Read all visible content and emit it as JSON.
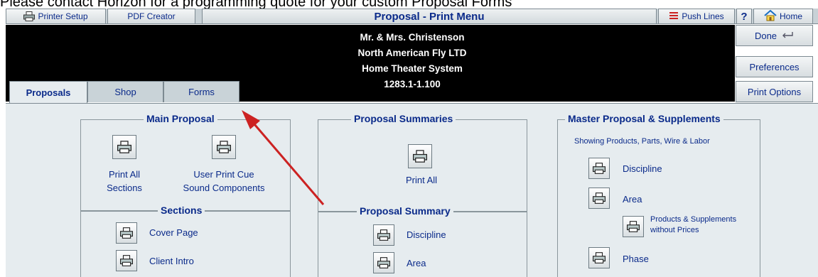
{
  "caption": "Please contact Horizon for a programming quote for your custom Proposal Forms",
  "toolbar": {
    "printer_setup": "Printer Setup",
    "pdf_creator": "PDF Creator",
    "title": "Proposal - Print Menu",
    "push_lines": "Push Lines",
    "help": "?",
    "home": "Home"
  },
  "client": {
    "name": "Mr. & Mrs. Christenson",
    "company": "North American Fly LTD",
    "project": "Home Theater System",
    "number": "1283.1-1.100"
  },
  "side": {
    "done": "Done",
    "preferences": "Preferences",
    "print_options": "Print Options"
  },
  "tabs": [
    "Proposals",
    "Shop",
    "Forms"
  ],
  "main_proposal": {
    "title": "Main Proposal",
    "print_all": "Print All\nSections",
    "user_print": "User Print Cue\nSound Components"
  },
  "sections": {
    "title": "Sections",
    "items": [
      "Cover Page",
      "Client Intro"
    ]
  },
  "summaries": {
    "title": "Proposal Summaries",
    "print_all": "Print All"
  },
  "summary": {
    "title": "Proposal Summary",
    "items": [
      "Discipline",
      "Area"
    ]
  },
  "master": {
    "title": "Master Proposal & Supplements",
    "subtitle": "Showing Products, Parts, Wire & Labor",
    "discipline": "Discipline",
    "area": "Area",
    "products": "Products & Supplements\nwithout Prices",
    "phase": "Phase"
  },
  "colors": {
    "label_blue": "#0a2a8a",
    "panel": "#e6ecef",
    "arrow": "#cc2222"
  }
}
